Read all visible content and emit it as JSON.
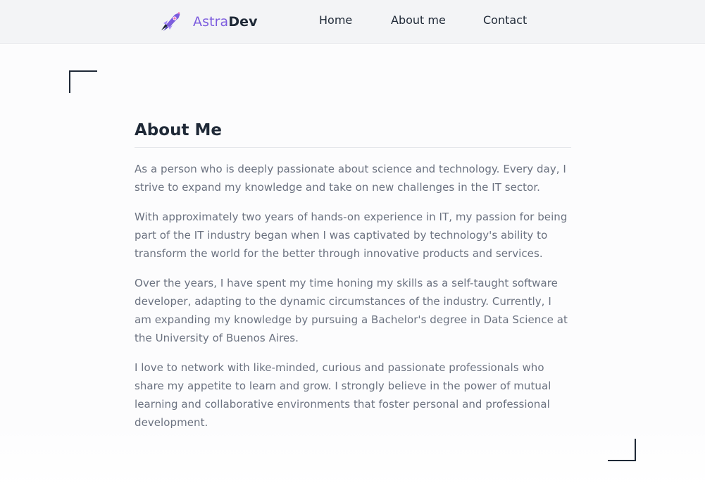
{
  "header": {
    "brand": {
      "accent": "Astra",
      "strong": "Dev",
      "logo_icon": "rocket-icon"
    },
    "nav": [
      {
        "label": "Home"
      },
      {
        "label": "About me"
      },
      {
        "label": "Contact"
      }
    ]
  },
  "main": {
    "title": "About Me",
    "paragraphs": [
      "As a person who is deeply passionate about science and technology. Every day, I strive to expand my knowledge and take on new challenges in the IT sector.",
      "With approximately two years of hands-on experience in IT, my passion for being part of the IT industry began when I was captivated by technology's ability to transform the world for the better through innovative products and services.",
      "Over the years, I have spent my time honing my skills as a self-taught software developer, adapting to the dynamic circumstances of the industry. Currently, I am expanding my knowledge by pursuing a Bachelor's degree in Data Science at the University of Buenos Aires.",
      "I love to network with like-minded, curious and passionate professionals who share my appetite to learn and grow. I strongly believe in the power of mutual learning and collaborative environments that foster personal and professional development."
    ]
  },
  "colors": {
    "accent": "#7c5cde",
    "text_dark": "#1f2937",
    "text_muted": "#6b7280",
    "header_bg": "#f3f4f6"
  }
}
